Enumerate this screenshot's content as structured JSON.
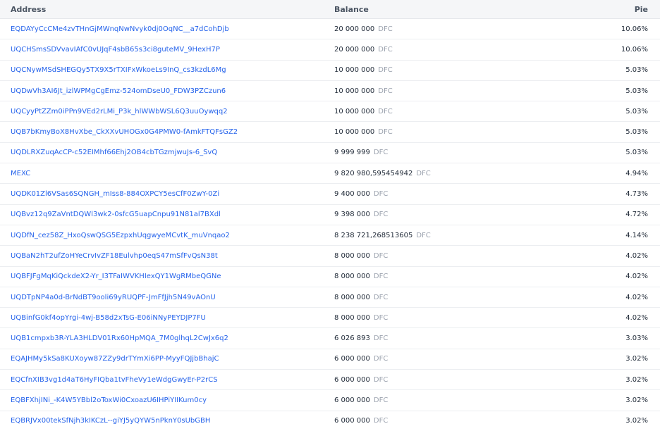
{
  "table": {
    "headers": {
      "address": "Address",
      "balance": "Balance",
      "pie": "Pie"
    },
    "rows": [
      {
        "address": "EQDAYyCcCMe4zvTHnGjMWnqNwNvyk0dj0OqNC__a7dCohDjb",
        "balance": "20 000 000",
        "ticker": "DFC",
        "pie": "10.06%"
      },
      {
        "address": "UQCHSmsSDVvavIAfC0vUJqF4sbB65s3ci8guteMV_9HexH7P",
        "balance": "20 000 000",
        "ticker": "DFC",
        "pie": "10.06%"
      },
      {
        "address": "UQCNywMSdSHEGQy5TX9X5rTXIFxWkoeLs9InQ_cs3kzdL6Mg",
        "balance": "10 000 000",
        "ticker": "DFC",
        "pie": "5.03%"
      },
      {
        "address": "UQDwVh3AI6Jt_izlWPMgCgEmz-524omDseU0_FDW3PZCzun6",
        "balance": "10 000 000",
        "ticker": "DFC",
        "pie": "5.03%"
      },
      {
        "address": "UQCyyPtZZm0iPPn9VEd2rLMi_P3k_hlWWbWSL6Q3uuOywqq2",
        "balance": "10 000 000",
        "ticker": "DFC",
        "pie": "5.03%"
      },
      {
        "address": "UQB7bKmyBoX8HvXbe_CkXXvUHOGx0G4PMW0-fAmkFTQFsGZ2",
        "balance": "10 000 000",
        "ticker": "DFC",
        "pie": "5.03%"
      },
      {
        "address": "UQDLRXZuqAcCP-c52EIMhf66Ehj2OB4cbTGzmjwuJs-6_SvQ",
        "balance": "9 999 999",
        "ticker": "DFC",
        "pie": "5.03%"
      },
      {
        "address": "MEXC",
        "balance": "9 820 980,595454942",
        "ticker": "DFC",
        "pie": "4.94%"
      },
      {
        "address": "UQDK01Zl6VSas6SQNGH_mIss8-884OXPCY5esCfF0ZwY-0Zi",
        "balance": "9 400 000",
        "ticker": "DFC",
        "pie": "4.73%"
      },
      {
        "address": "UQBvz12q9ZaVntDQWl3wk2-0sfcG5uapCnpu91N81al7BXdl",
        "balance": "9 398 000",
        "ticker": "DFC",
        "pie": "4.72%"
      },
      {
        "address": "UQDfN_cez58Z_HxoQswQSG5EzpxhUqgwyeMCvtK_muVnqao2",
        "balance": "8 238 721,268513605",
        "ticker": "DFC",
        "pie": "4.14%"
      },
      {
        "address": "UQBaN2hT2ufZoHYeCrvIvZF18Eulvhp0eqS47mSfFvQsN38t",
        "balance": "8 000 000",
        "ticker": "DFC",
        "pie": "4.02%"
      },
      {
        "address": "UQBFJFgMqKiQckdeX2-Yr_I3TFaIWVKHIexQY1WgRMbeQGNe",
        "balance": "8 000 000",
        "ticker": "DFC",
        "pie": "4.02%"
      },
      {
        "address": "UQDTpNP4a0d-BrNdBT9ooli69yRUQPF-JmFfJjh5N49vAOnU",
        "balance": "8 000 000",
        "ticker": "DFC",
        "pie": "4.02%"
      },
      {
        "address": "UQBinfG0kf4opYrgi-4wj-B58d2xTsG-E06iNNyPEYDJP7FU",
        "balance": "8 000 000",
        "ticker": "DFC",
        "pie": "4.02%"
      },
      {
        "address": "UQB1cmpxb3R-YLA3HLDV01Rx60HpMQA_7M0glhqL2CwJx6q2",
        "balance": "6 026 893",
        "ticker": "DFC",
        "pie": "3.03%"
      },
      {
        "address": "EQAJHMy5kSa8KUXoyw87ZZy9drTYmXi6PP-MyyFQJjbBhajC",
        "balance": "6 000 000",
        "ticker": "DFC",
        "pie": "3.02%"
      },
      {
        "address": "EQCfnXIB3vg1d4aT6HyFIQba1tvFheVy1eWdgGwyEr-P2rCS",
        "balance": "6 000 000",
        "ticker": "DFC",
        "pie": "3.02%"
      },
      {
        "address": "EQBFXhjINi_-K4W5YBbl2oToxWi0CxoazU6IHPiYIIKum0cy",
        "balance": "6 000 000",
        "ticker": "DFC",
        "pie": "3.02%"
      },
      {
        "address": "EQBRJVx00tekSfNjh3kIKCzL--giYJ5yQYW5nPknY0sUbGBH",
        "balance": "6 000 000",
        "ticker": "DFC",
        "pie": "3.02%"
      }
    ]
  },
  "colors": {
    "link": "#2563eb",
    "ticker": "#9ca3af",
    "header_bg": "#f5f6f8"
  }
}
